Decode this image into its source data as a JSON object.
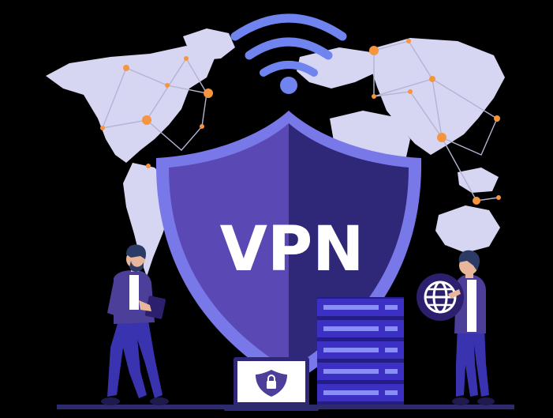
{
  "shield": {
    "label": "VPN"
  },
  "colors": {
    "background": "#000000",
    "map": "#d6d6f3",
    "map_node": "#f6953f",
    "map_line": "#bdbdd6",
    "shield_outline": "#7878e8",
    "shield_left": "#5a49b4",
    "shield_right": "#2f2777",
    "wifi": "#6f84ef",
    "server": "#3b2fc4",
    "server_slot": "#8a8ff5",
    "person_suit": "#3a33b0",
    "person_jacket": "#4b3f9a",
    "globe": "#2c1f6d"
  },
  "icons": [
    "wifi-icon",
    "shield-icon",
    "globe-icon",
    "lock-icon",
    "server-rack-icon",
    "laptop-icon"
  ]
}
